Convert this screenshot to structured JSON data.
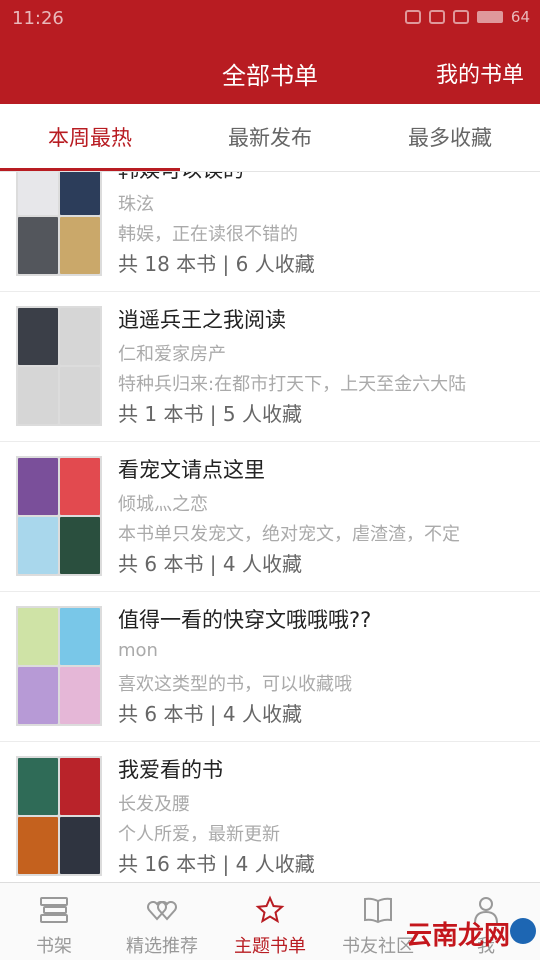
{
  "status_bar": {
    "time": "11:26",
    "battery": "64"
  },
  "header": {
    "title": "全部书单",
    "my_lists": "我的书单"
  },
  "tabs": [
    {
      "label": "本周最热",
      "active": true
    },
    {
      "label": "最新发布",
      "active": false
    },
    {
      "label": "最多收藏",
      "active": false
    }
  ],
  "colors": {
    "brand": "#b81c22",
    "muted": "#aaaaaa"
  },
  "booklists": [
    {
      "name": "韩娱可以误的",
      "author": "珠泫",
      "desc": "韩娱，正在读很不错的",
      "stats": "共 18 本书 | 6 人收藏",
      "cover_colors": [
        "#e7e7ea",
        "#2c3d5a",
        "#53565c",
        "#caa86a"
      ]
    },
    {
      "name": "逍遥兵王之我阅读",
      "author": "仁和爱家房产",
      "desc": "特种兵归来:在都市打天下，上天至金六大陆",
      "stats": "共 1 本书 | 5 人收藏",
      "cover_colors": [
        "#3b3f48",
        "#d6d6d6",
        "#d6d6d6",
        "#d6d6d6"
      ]
    },
    {
      "name": "看宠文请点这里",
      "author": "倾城灬之恋",
      "desc": "本书单只发宠文，绝对宠文，虐渣渣，不定",
      "stats": "共 6 本书 | 4 人收藏",
      "cover_colors": [
        "#7a4f9a",
        "#e24a4f",
        "#a9d7ec",
        "#2a4f3e"
      ]
    },
    {
      "name": "值得一看的快穿文哦哦哦??",
      "author": "mon",
      "desc": "喜欢这类型的书，可以收藏哦",
      "stats": "共 6 本书 | 4 人收藏",
      "cover_colors": [
        "#cfe3a6",
        "#79c7e8",
        "#b79ad6",
        "#e5b7d7"
      ]
    },
    {
      "name": "我爱看的书",
      "author": "长发及腰",
      "desc": "个人所爱，最新更新",
      "stats": "共 16 本书 | 4 人收藏",
      "cover_colors": [
        "#2f6b57",
        "#b9232a",
        "#c4611e",
        "#2f3440"
      ]
    }
  ],
  "bottom_nav": [
    {
      "label": "书架",
      "icon": "bookshelf-icon",
      "active": false
    },
    {
      "label": "精选推荐",
      "icon": "hearts-icon",
      "active": false
    },
    {
      "label": "主题书单",
      "icon": "star-icon",
      "active": true
    },
    {
      "label": "书友社区",
      "icon": "book-icon",
      "active": false
    },
    {
      "label": "我",
      "icon": "user-icon",
      "active": false
    }
  ],
  "watermark": {
    "text": "云南龙网"
  }
}
